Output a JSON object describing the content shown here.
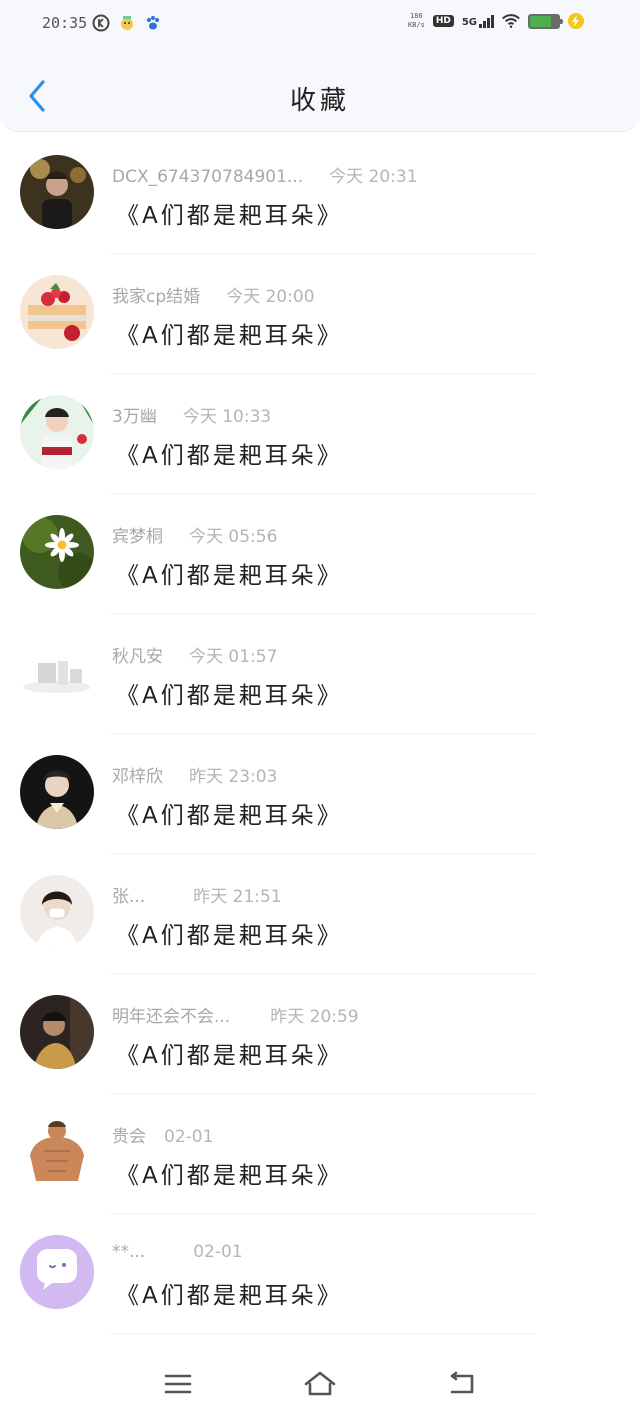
{
  "status_bar": {
    "time": "20:35",
    "net_speed_top": "186",
    "net_speed_bottom": "KB/s",
    "hd_label": "HD",
    "network_label": "5G",
    "battery_percent": 75,
    "colors": {
      "battery": "#4caf50",
      "charging": "#f5c518"
    }
  },
  "header": {
    "title": "收藏",
    "back_icon": "chevron-left-icon",
    "accent_color": "#2d8cf0"
  },
  "items": [
    {
      "name": "DCX_674370784901...",
      "time": "今天 20:31",
      "title": "《A们都是耙耳朵》"
    },
    {
      "name": "我家cp结婚",
      "time": "今天 20:00",
      "title": "《A们都是耙耳朵》"
    },
    {
      "name": "3万幽",
      "time": "今天 10:33",
      "title": "《A们都是耙耳朵》"
    },
    {
      "name": "宾梦桐",
      "time": "今天 05:56",
      "title": "《A们都是耙耳朵》"
    },
    {
      "name": "秋凡安",
      "time": "今天 01:57",
      "title": "《A们都是耙耳朵》"
    },
    {
      "name": "邓梓欣",
      "time": "昨天 23:03",
      "title": "《A们都是耙耳朵》"
    },
    {
      "name": "张...",
      "time": "昨天 21:51",
      "title": "《A们都是耙耳朵》"
    },
    {
      "name": "明年还会不会...",
      "time": "昨天 20:59",
      "title": "《A们都是耙耳朵》"
    },
    {
      "name": "贵会",
      "time": "02-01",
      "title": "《A们都是耙耳朵》"
    },
    {
      "name": "**...",
      "time": "02-01",
      "title": "《A们都是耙耳朵》"
    }
  ],
  "bottom_nav": {
    "menu_icon": "menu-icon",
    "home_icon": "home-icon",
    "back_icon": "back-arrow-icon"
  }
}
